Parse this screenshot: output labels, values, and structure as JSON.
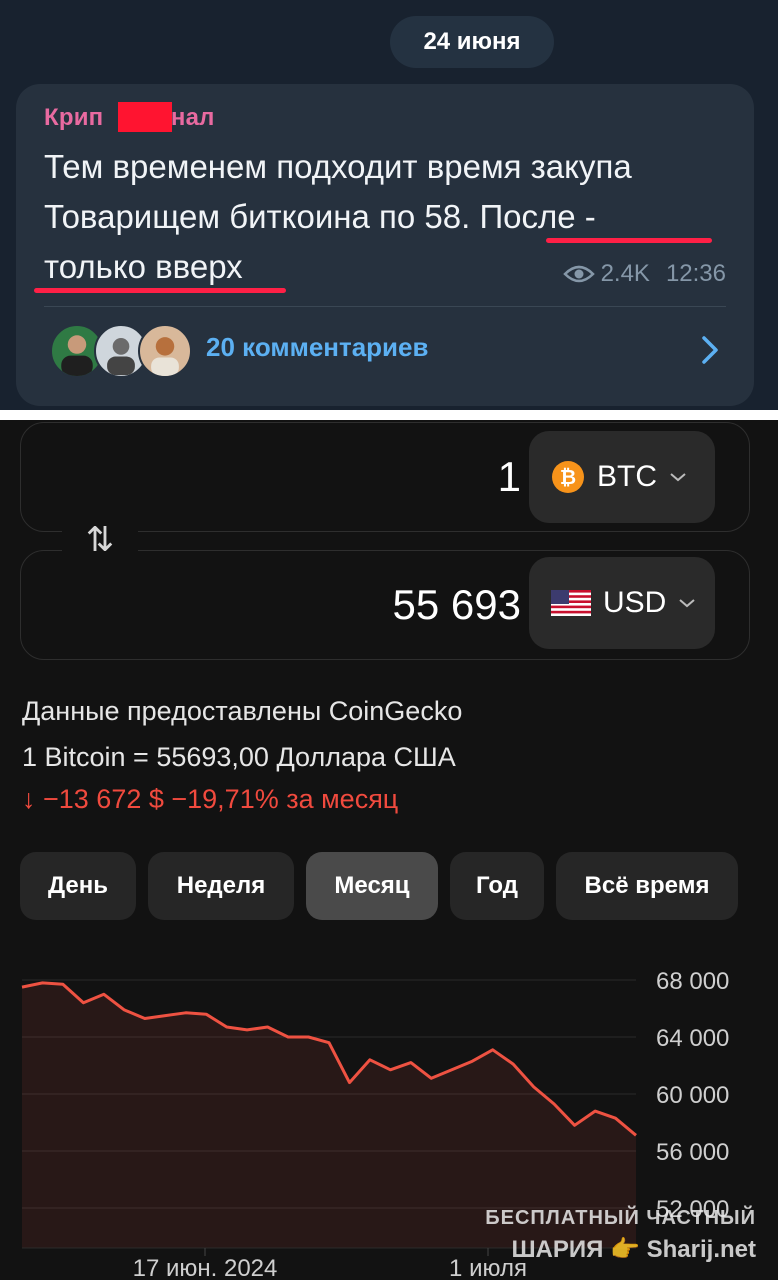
{
  "telegram": {
    "date": "24 июня",
    "channel_prefix": "Крип",
    "channel_suffix": "анал",
    "message_lines": [
      "Тем временем подходит время закупа",
      "Товарищем биткоина по 58. После -",
      "только вверх"
    ],
    "views": "2.4K",
    "time": "12:36",
    "comments": "20 комментариев",
    "colors": {
      "channel": "#e86aa0",
      "underline": "#ff2046",
      "link": "#5cb0f2"
    }
  },
  "converter": {
    "from": {
      "amount": "1",
      "currency": "BTC",
      "icon": "bitcoin-icon"
    },
    "to": {
      "amount": "55 693",
      "currency": "USD",
      "icon": "us-flag-icon"
    },
    "swap_icon": "swap-arrows-icon",
    "source": "Данные предоставлены CoinGecko",
    "rate": "1 Bitcoin = 55693,00 Доллара США",
    "change": "↓ −13 672 $ −19,71% за месяц"
  },
  "periods": [
    {
      "label": "День",
      "active": false
    },
    {
      "label": "Неделя",
      "active": false
    },
    {
      "label": "Месяц",
      "active": true
    },
    {
      "label": "Год",
      "active": false
    },
    {
      "label": "Всё время",
      "active": false
    }
  ],
  "chart_data": {
    "type": "line",
    "series": [
      {
        "values": [
          67500,
          67800,
          67700,
          66400,
          67000,
          65900,
          65300,
          65500,
          65700,
          65600,
          64700,
          64500,
          64700,
          64000,
          64000,
          63600,
          60800,
          62400,
          61700,
          62200,
          61100,
          61700,
          62300,
          63100,
          62100,
          60500,
          59300,
          57800,
          58800,
          58300,
          57100
        ]
      }
    ],
    "yticks": [
      "68 000",
      "64 000",
      "60 000",
      "56 000",
      "52 000"
    ],
    "ylim": [
      52000,
      68000
    ],
    "xticks": [
      "17 июн. 2024",
      "1 июля"
    ],
    "grid": true,
    "color": "#ee5242"
  },
  "watermark": {
    "line1": "БЕСПЛАТНЫЙ ЧАСТНЫЙ",
    "line2_left": "ШАРИЯ",
    "line2_right": "Sharij.net"
  }
}
